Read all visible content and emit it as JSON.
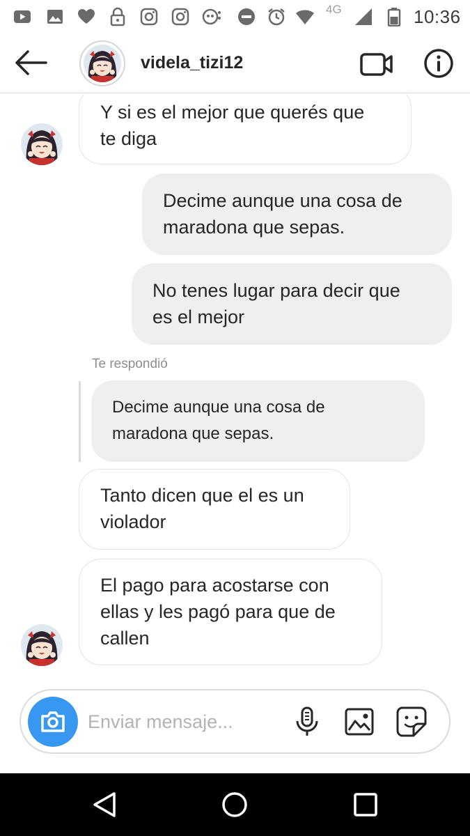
{
  "status_bar": {
    "network": "4G",
    "time": "10:36",
    "icons": [
      "youtube-icon",
      "gallery-icon",
      "heart-icon",
      "lock-icon",
      "instagram-icon",
      "instagram-icon",
      "assistant-icon",
      "do-not-disturb-icon",
      "alarm-icon",
      "wifi-icon",
      "signal-icon",
      "battery-icon"
    ]
  },
  "header": {
    "username": "videla_tizi12",
    "icons": [
      "back-arrow-icon",
      "video-call-icon",
      "info-icon"
    ]
  },
  "messages": [
    {
      "side": "incoming",
      "lines": [
        "Y si es el mejor que querés que",
        "te diga"
      ]
    },
    {
      "side": "outgoing",
      "lines": [
        "Decime aunque una cosa de",
        "maradona que sepas."
      ]
    },
    {
      "side": "outgoing",
      "lines": [
        "No tenes lugar para decir que",
        "es el mejor"
      ]
    },
    {
      "side": "incoming",
      "reply_label": "Te respondió",
      "quoted_lines": [
        "Decime aunque una cosa de",
        "maradona que sepas."
      ],
      "lines": [
        "Tanto dicen que el es un",
        "violador"
      ]
    },
    {
      "side": "incoming",
      "lines": [
        "El pago para acostarse con",
        "ellas y les pagó para que de",
        "callen"
      ]
    }
  ],
  "composer": {
    "placeholder": "Enviar mensaje...",
    "icons": [
      "camera-icon",
      "microphone-icon",
      "gallery-icon",
      "sticker-icon"
    ]
  },
  "colors": {
    "camera_button": "#3897f0",
    "outgoing_bubble": "#efefef",
    "incoming_border": "#e4e4e4",
    "secondary_text": "#8e8e8e"
  },
  "nav_bar": {
    "icons": [
      "back-triangle-icon",
      "home-circle-icon",
      "recents-square-icon"
    ]
  }
}
